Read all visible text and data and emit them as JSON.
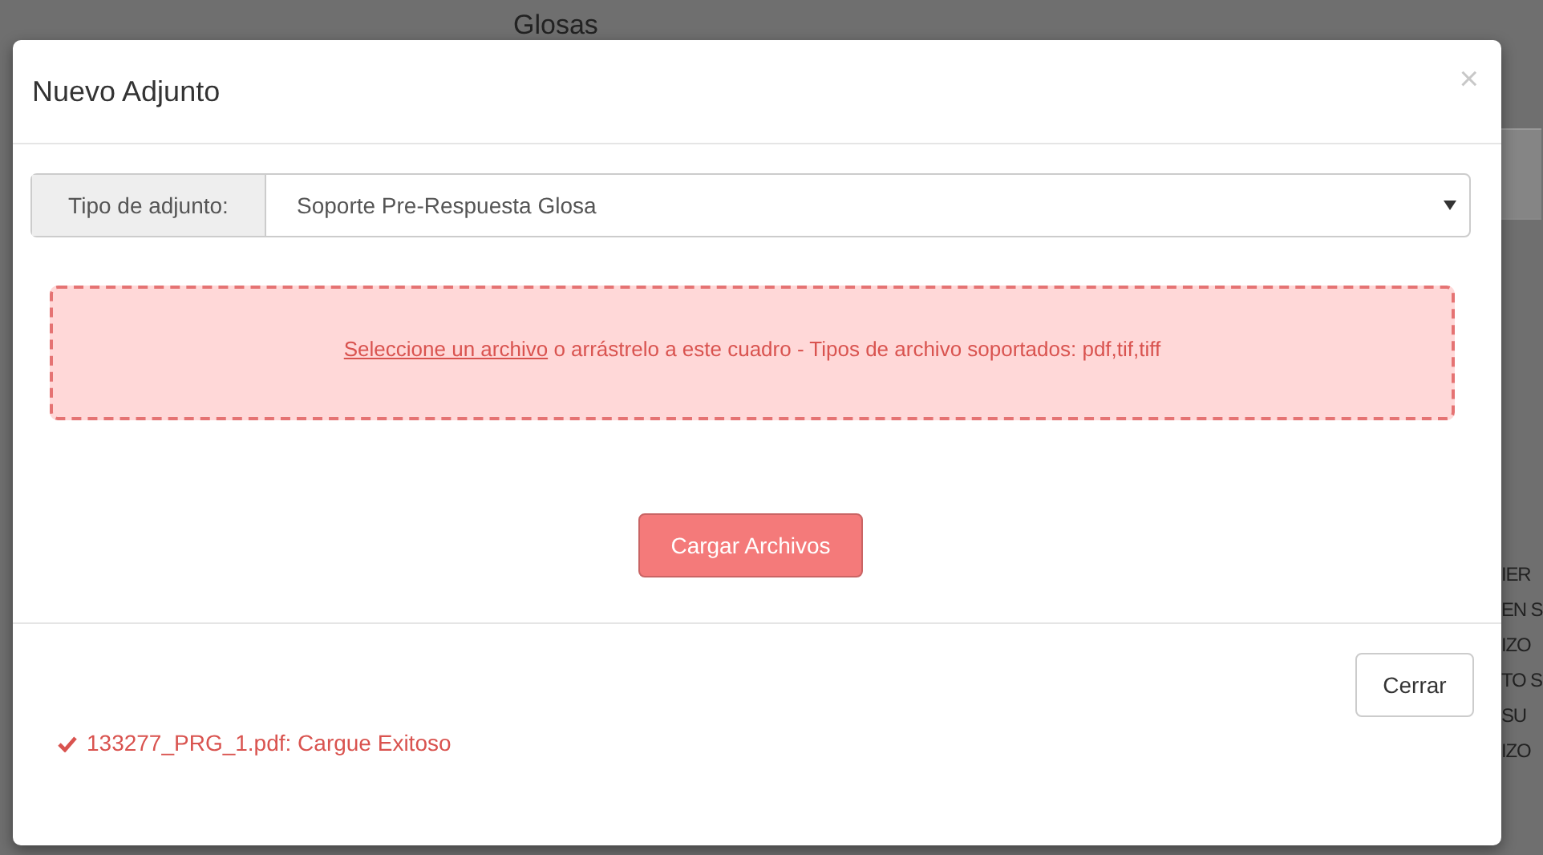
{
  "background": {
    "title": "Glosas",
    "text_fragments": [
      "IER",
      "EN S",
      "IZO",
      "TO S",
      "SU",
      "IZO"
    ]
  },
  "modal": {
    "title": "Nuevo Adjunto",
    "close": "×",
    "attachment_type": {
      "label": "Tipo de adjunto:",
      "value": "Soporte Pre-Respuesta Glosa"
    },
    "dropzone": {
      "link": "Seleccione un archivo",
      "text": "o arrástrelo a este cuadro - Tipos de archivo soportados: pdf,tif,tiff"
    },
    "upload_button": "Cargar Archivos",
    "upload_results": [
      {
        "kind": "success",
        "text": "133277_PRG_1.pdf: Cargue Exitoso"
      }
    ],
    "close_button": "Cerrar"
  }
}
